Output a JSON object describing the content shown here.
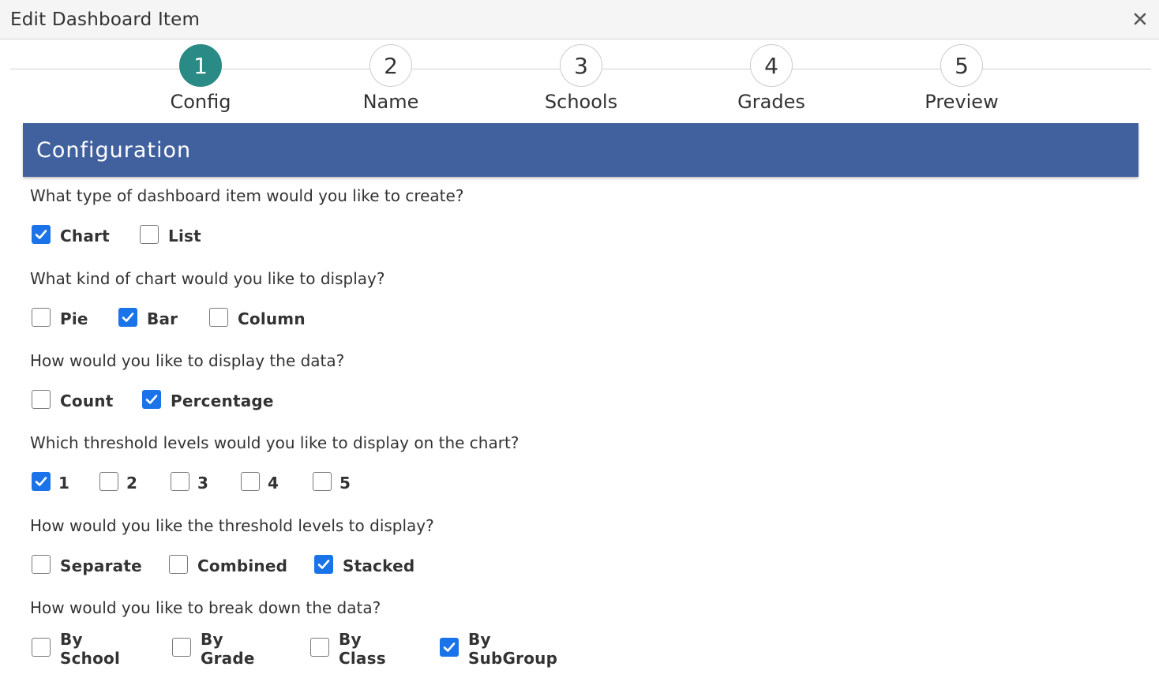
{
  "dialog": {
    "title": "Edit Dashboard Item",
    "close_icon": "close-icon"
  },
  "stepper": {
    "active_step": 1,
    "steps": [
      {
        "number": "1",
        "label": "Config"
      },
      {
        "number": "2",
        "label": "Name"
      },
      {
        "number": "3",
        "label": "Schools"
      },
      {
        "number": "4",
        "label": "Grades"
      },
      {
        "number": "5",
        "label": "Preview"
      }
    ]
  },
  "section": {
    "title": "Configuration"
  },
  "questions": [
    {
      "text": "What type of dashboard item would you like to create?",
      "options": [
        {
          "label": "Chart",
          "checked": true
        },
        {
          "label": "List",
          "checked": false
        }
      ]
    },
    {
      "text": "What kind of chart would you like to display?",
      "options": [
        {
          "label": "Pie",
          "checked": false
        },
        {
          "label": "Bar",
          "checked": true
        },
        {
          "label": "Column",
          "checked": false
        }
      ]
    },
    {
      "text": "How would you like to display the data?",
      "options": [
        {
          "label": "Count",
          "checked": false
        },
        {
          "label": "Percentage",
          "checked": true
        }
      ]
    },
    {
      "text": "Which threshold levels would you like to display on the chart?",
      "options": [
        {
          "label": "1",
          "checked": true
        },
        {
          "label": "2",
          "checked": false
        },
        {
          "label": "3",
          "checked": false
        },
        {
          "label": "4",
          "checked": false
        },
        {
          "label": "5",
          "checked": false
        }
      ]
    },
    {
      "text": "How would you like the threshold levels to display?",
      "options": [
        {
          "label": "Separate",
          "checked": false
        },
        {
          "label": "Combined",
          "checked": false
        },
        {
          "label": "Stacked",
          "checked": true
        }
      ]
    },
    {
      "text": "How would you like to break down the data?",
      "options": [
        {
          "label": "By School",
          "checked": false
        },
        {
          "label": "By Grade",
          "checked": false
        },
        {
          "label": "By Class",
          "checked": false
        },
        {
          "label": "By SubGroup",
          "checked": true
        }
      ]
    }
  ],
  "colors": {
    "header_bg": "#41609e",
    "active_step": "#2a8a86",
    "checkbox_checked": "#1a73e8"
  }
}
